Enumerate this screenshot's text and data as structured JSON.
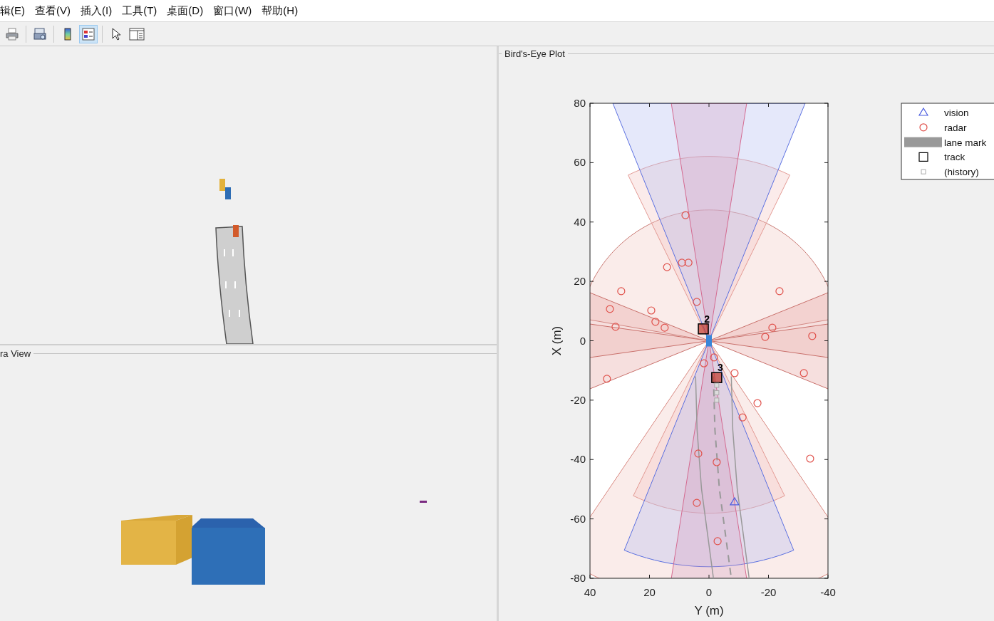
{
  "menu": [
    {
      "label": "辑(E)"
    },
    {
      "label": "查看(V)"
    },
    {
      "label": "插入(I)"
    },
    {
      "label": "工具(T)"
    },
    {
      "label": "桌面(D)"
    },
    {
      "label": "窗口(W)"
    },
    {
      "label": "帮助(H)"
    }
  ],
  "toolbar": [
    {
      "kind": "print",
      "selected": false
    },
    {
      "kind": "separator"
    },
    {
      "kind": "print-preview",
      "selected": false
    },
    {
      "kind": "separator"
    },
    {
      "kind": "colorbar",
      "selected": false
    },
    {
      "kind": "legend",
      "selected": true
    },
    {
      "kind": "separator"
    },
    {
      "kind": "pointer",
      "selected": false
    },
    {
      "kind": "property-editor",
      "selected": false
    }
  ],
  "camera_panel": {
    "title": "ra View"
  },
  "birds_eye_panel": {
    "title": "Bird's-Eye Plot",
    "chart_data": {
      "type": "scatter",
      "xlabel": "Y (m)",
      "ylabel": "X (m)",
      "xlim": [
        40,
        -40
      ],
      "ylim": [
        -80,
        80
      ],
      "xticks": [
        {
          "value": 40,
          "label": "40"
        },
        {
          "value": 20,
          "label": "20"
        },
        {
          "value": 0,
          "label": "0"
        },
        {
          "value": -20,
          "label": "-20"
        },
        {
          "value": -40,
          "label": "-40"
        }
      ],
      "yticks": [
        {
          "value": -80,
          "label": "-80"
        },
        {
          "value": -60,
          "label": "-60"
        },
        {
          "value": -40,
          "label": "-40"
        },
        {
          "value": -20,
          "label": "-20"
        },
        {
          "value": 0,
          "label": "0"
        },
        {
          "value": 20,
          "label": "20"
        },
        {
          "value": 40,
          "label": "40"
        },
        {
          "value": 60,
          "label": "60"
        },
        {
          "value": 80,
          "label": "80"
        }
      ],
      "series": [
        {
          "name": "vision",
          "marker": "triangle",
          "color": "#4b5de0",
          "x": [
            -8.6
          ],
          "values": [
            -54.3
          ]
        },
        {
          "name": "radar",
          "marker": "circle",
          "color": "#e0504a",
          "x": [
            7.9,
            14.1,
            9.1,
            6.9,
            29.5,
            33.3,
            31.4,
            19.4,
            18.0,
            14.9,
            4.1,
            -23.7,
            -21.3,
            -18.9,
            -34.7,
            -31.9,
            34.3,
            1.7,
            -1.7,
            -8.6,
            -16.3,
            -11.3,
            3.6,
            -2.6,
            -34.0,
            4.1,
            -2.9
          ],
          "values": [
            42.3,
            24.8,
            26.3,
            26.3,
            16.7,
            10.7,
            4.7,
            10.2,
            6.4,
            4.4,
            13.1,
            16.7,
            4.4,
            1.3,
            1.6,
            -10.9,
            -12.8,
            -7.6,
            -5.6,
            -10.9,
            -21.0,
            -25.8,
            -38.0,
            -40.9,
            -39.7,
            -54.6,
            -67.5
          ]
        },
        {
          "name": "lane mark",
          "type": "line",
          "marker": "none",
          "line_style": "dashed",
          "color": "#999999",
          "x": [
            -1.5,
            -2,
            -3.5,
            -5.5,
            -7.5
          ],
          "values": [
            -12,
            -30,
            -50,
            -65,
            -80
          ]
        },
        {
          "name": "track",
          "marker": "square",
          "color": "#000000",
          "x": [
            1.9,
            -2.6
          ],
          "values": [
            4.0,
            -12.4
          ]
        },
        {
          "name": "(history)",
          "marker": "square",
          "color": "#aaaaaa",
          "x": [
            -2.6,
            -2.6,
            -2.6
          ],
          "values": [
            -15,
            -17.5,
            -20
          ]
        }
      ],
      "legend": "outside upper right",
      "annotations": [
        {
          "x": 1.9,
          "y": 4.0,
          "text": "2"
        },
        {
          "x": -2.6,
          "y": -12.4,
          "text": "3"
        }
      ]
    }
  }
}
